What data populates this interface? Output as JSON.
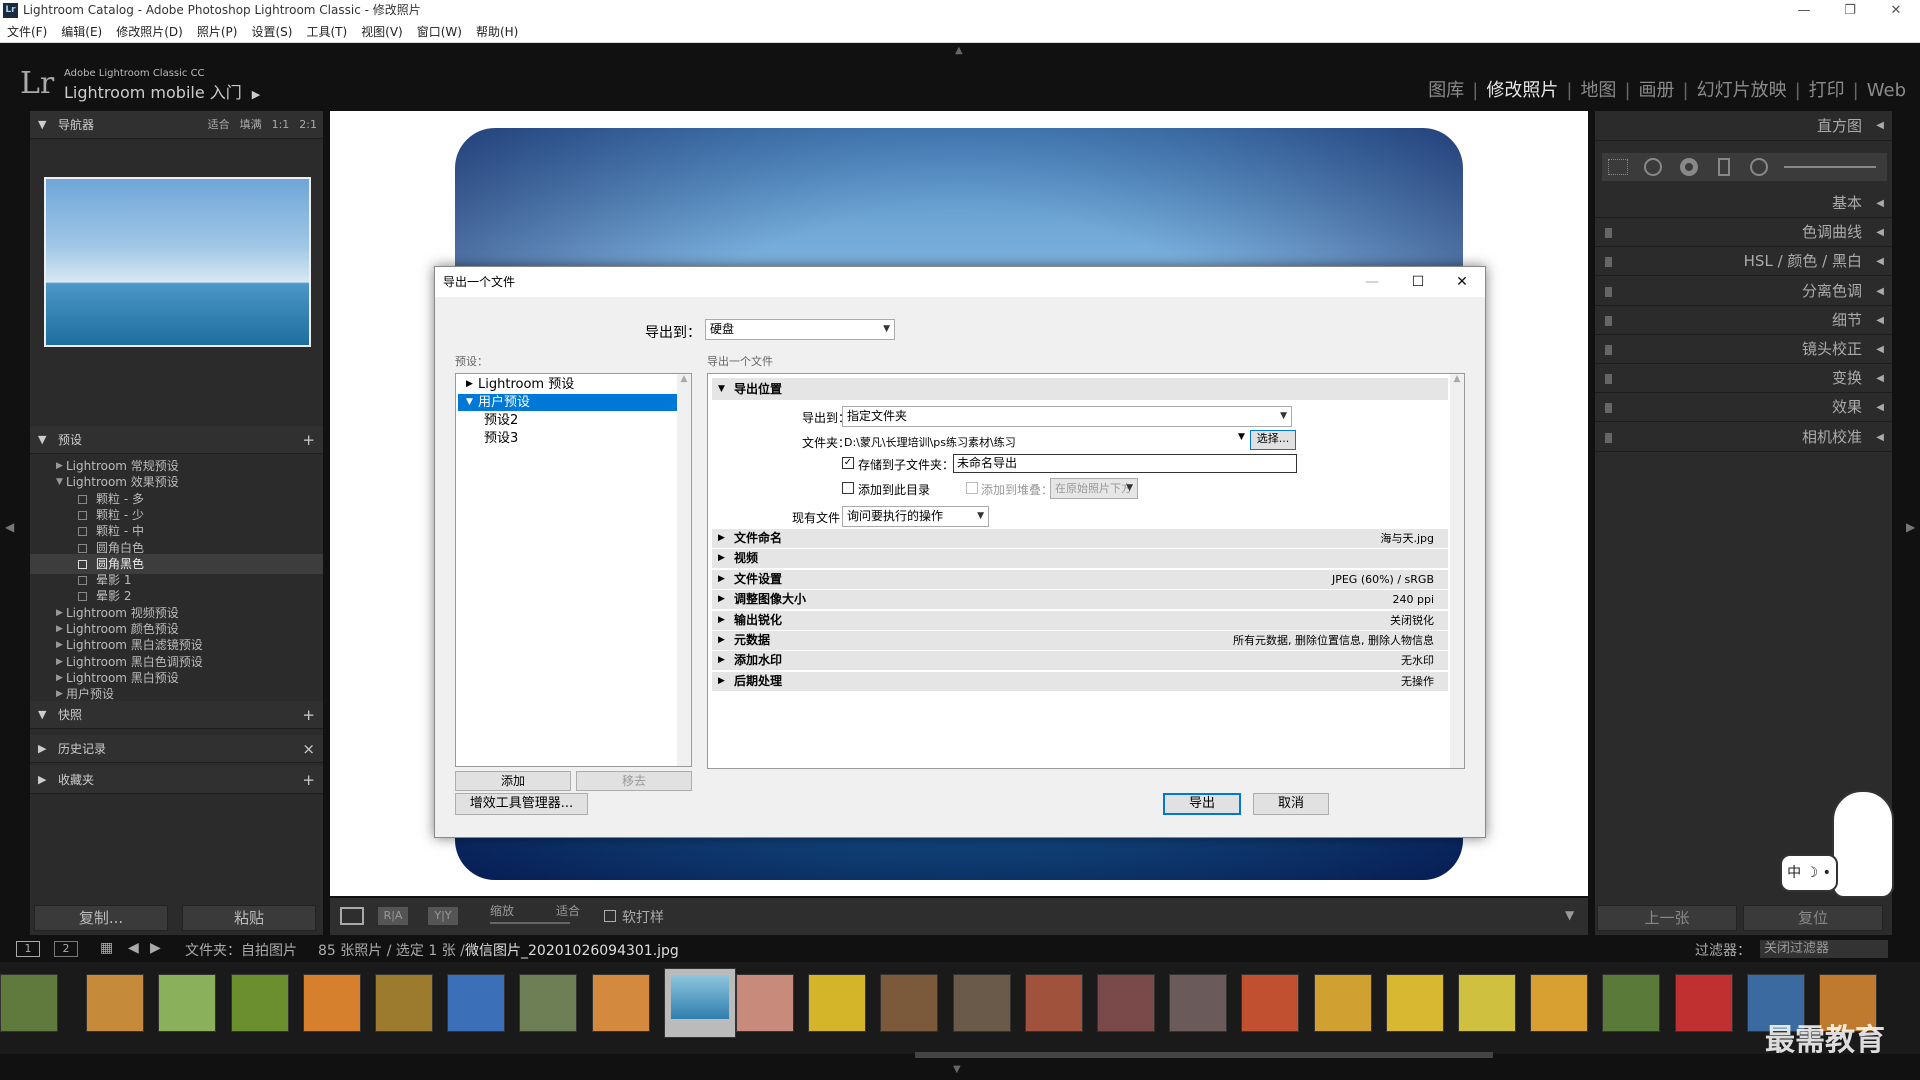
{
  "window": {
    "title": "Lightroom Catalog - Adobe Photoshop Lightroom Classic - 修改照片",
    "app_icon": "Lr"
  },
  "menu": [
    "文件(F)",
    "编辑(E)",
    "修改照片(D)",
    "照片(P)",
    "设置(S)",
    "工具(T)",
    "视图(V)",
    "窗口(W)",
    "帮助(H)"
  ],
  "identity": {
    "logo": "Lr",
    "small": "Adobe Lightroom Classic CC",
    "big": "Lightroom mobile 入门",
    "arrow": "▶"
  },
  "modules": [
    {
      "label": "图库"
    },
    {
      "label": "修改照片",
      "active": true
    },
    {
      "label": "地图"
    },
    {
      "label": "画册"
    },
    {
      "label": "幻灯片放映"
    },
    {
      "label": "打印"
    },
    {
      "label": "Web"
    }
  ],
  "left": {
    "navigator": {
      "title": "导航器",
      "opts": [
        "适合",
        "填满",
        "1:1",
        "2:1"
      ]
    },
    "presets": {
      "title": "预设",
      "add": "+",
      "items": [
        {
          "label": "Lightroom 常规预设",
          "type": "folder",
          "tri": "▶"
        },
        {
          "label": "Lightroom 效果预设",
          "type": "folder",
          "tri": "▼"
        },
        {
          "label": "颗粒 - 多",
          "type": "preset"
        },
        {
          "label": "颗粒 - 少",
          "type": "preset"
        },
        {
          "label": "颗粒 - 中",
          "type": "preset"
        },
        {
          "label": "圆角白色",
          "type": "preset"
        },
        {
          "label": "圆角黑色",
          "type": "preset",
          "selected": true
        },
        {
          "label": "晕影 1",
          "type": "preset"
        },
        {
          "label": "晕影 2",
          "type": "preset"
        },
        {
          "label": "Lightroom 视频预设",
          "type": "folder",
          "tri": "▶"
        },
        {
          "label": "Lightroom 颜色预设",
          "type": "folder",
          "tri": "▶"
        },
        {
          "label": "Lightroom 黑白滤镜预设",
          "type": "folder",
          "tri": "▶"
        },
        {
          "label": "Lightroom 黑白色调预设",
          "type": "folder",
          "tri": "▶"
        },
        {
          "label": "Lightroom 黑白预设",
          "type": "folder",
          "tri": "▶"
        },
        {
          "label": "用户预设",
          "type": "folder",
          "tri": "▶"
        }
      ]
    },
    "snapshots": {
      "title": "快照",
      "act": "+"
    },
    "history": {
      "title": "历史记录",
      "act": "×"
    },
    "collections": {
      "title": "收藏夹",
      "act": "+"
    },
    "copy": "复制...",
    "paste": "粘贴"
  },
  "right": {
    "histogram": "直方图",
    "panels": [
      "基本",
      "色调曲线",
      "HSL / 颜色 / 黑白",
      "分离色调",
      "细节",
      "镜头校正",
      "变换",
      "效果",
      "相机校准"
    ],
    "prev": "上一张",
    "reset": "复位"
  },
  "toolbar": {
    "zoom_label": "缩放",
    "zoom_value": "适合",
    "soft_proof": "软打样",
    "view_ry": "R|A",
    "view_yy": "Y|Y"
  },
  "strip": {
    "pages": [
      "1",
      "2"
    ],
    "source": "文件夹：自拍图片",
    "count": "85 张照片 / 选定 1 张 /",
    "filename": "微信图片_20201026094301.jpg",
    "filter_label": "过滤器：",
    "filter_value": "关闭过滤器"
  },
  "dialog": {
    "title": "导出一个文件",
    "export_to_label": "导出到：",
    "export_to_value": "硬盘",
    "presets_label": "预设：",
    "right_label": "导出一个文件",
    "presets": [
      {
        "label": "Lightroom 预设",
        "tri": "▶"
      },
      {
        "label": "用户预设",
        "tri": "▼",
        "selected": true
      },
      {
        "label": "预设2"
      },
      {
        "label": "预设3"
      }
    ],
    "add": "添加",
    "remove": "移去",
    "location": {
      "title": "导出位置",
      "export_to_label": "导出到：",
      "export_to_value": "指定文件夹",
      "folder_label": "文件夹：",
      "folder_value": "D:\\蒙凡\\长理培训\\ps练习素材\\练习",
      "choose": "选择...",
      "subfolder_label": "存储到子文件夹：",
      "subfolder_value": "未命名导出",
      "add_catalog": "添加到此目录",
      "add_stack": "添加到堆叠：",
      "stack_value": "在原始照片下方",
      "existing_label": "现有文件：",
      "existing_value": "询问要执行的操作"
    },
    "sections": [
      {
        "title": "文件命名",
        "summary": "海与天.jpg"
      },
      {
        "title": "视频",
        "summary": ""
      },
      {
        "title": "文件设置",
        "summary": "JPEG (60%) / sRGB"
      },
      {
        "title": "调整图像大小",
        "summary": "240 ppi"
      },
      {
        "title": "输出锐化",
        "summary": "关闭锐化"
      },
      {
        "title": "元数据",
        "summary": "所有元数据, 删除位置信息, 删除人物信息"
      },
      {
        "title": "添加水印",
        "summary": "无水印"
      },
      {
        "title": "后期处理",
        "summary": "无操作"
      }
    ],
    "plugin_manager": "增效工具管理器...",
    "export": "导出",
    "cancel": "取消"
  },
  "ime": {
    "label": "中 ☽ •"
  },
  "watermark": "最需教育",
  "colors": {
    "accent": "#0078d7",
    "panel": "#2b2b2b"
  }
}
